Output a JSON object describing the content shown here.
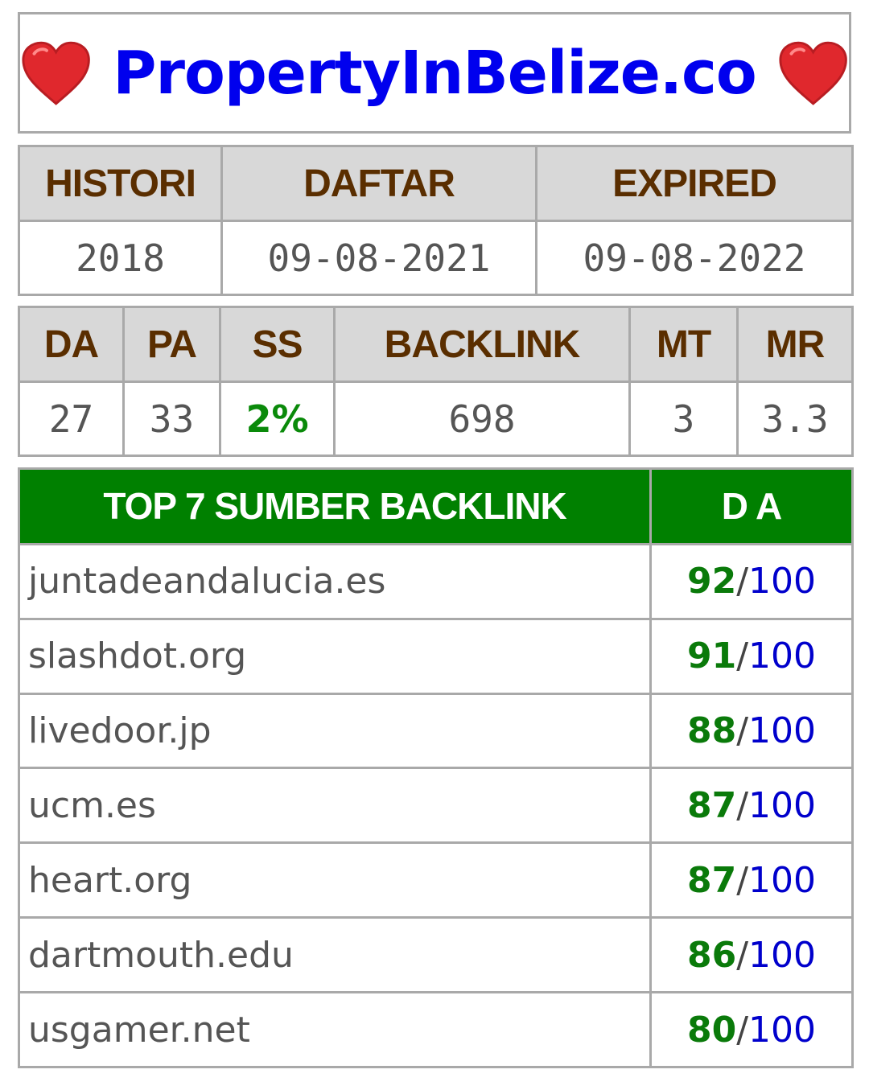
{
  "header": {
    "site_name": "PropertyInBelize.co",
    "heart_color": "#e0282d"
  },
  "dates": {
    "headers": [
      "HISTORI",
      "DAFTAR",
      "EXPIRED"
    ],
    "values": [
      "2018",
      "09-08-2021",
      "09-08-2022"
    ]
  },
  "metrics": {
    "headers": [
      "DA",
      "PA",
      "SS",
      "BACKLINK",
      "MT",
      "MR"
    ],
    "values": [
      "27",
      "33",
      "2%",
      "698",
      "3",
      "3.3"
    ]
  },
  "backlinks": {
    "header_source": "TOP 7 SUMBER BACKLINK",
    "header_da": "D A",
    "separator": "/",
    "max": "100",
    "rows": [
      {
        "domain": "juntadeandalucia.es",
        "score": "92"
      },
      {
        "domain": "slashdot.org",
        "score": "91"
      },
      {
        "domain": "livedoor.jp",
        "score": "88"
      },
      {
        "domain": "ucm.es",
        "score": "87"
      },
      {
        "domain": "heart.org",
        "score": "87"
      },
      {
        "domain": "dartmouth.edu",
        "score": "86"
      },
      {
        "domain": "usgamer.net",
        "score": "80"
      }
    ]
  },
  "colors": {
    "header_text": "#5a2e00",
    "header_bg": "#d8d8d8",
    "accent_green": "#008000",
    "link_blue": "#0000ee",
    "border": "#a9a9a9"
  }
}
